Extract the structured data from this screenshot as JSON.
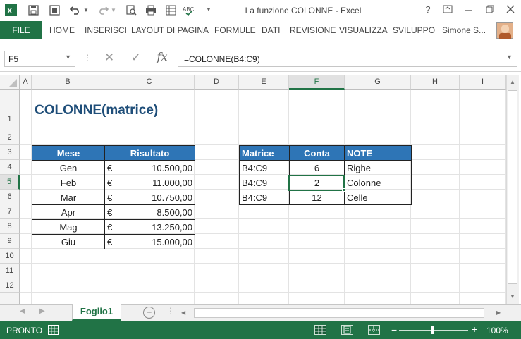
{
  "window": {
    "title": "La funzione COLONNE - Excel",
    "help": "?"
  },
  "ribbon": {
    "file_label": "FILE",
    "tabs": [
      "HOME",
      "INSERISCI",
      "LAYOUT DI PAGINA",
      "FORMULE",
      "DATI",
      "REVISIONE",
      "VISUALIZZA",
      "SVILUPPO"
    ],
    "user_name": "Simone S..."
  },
  "formula_bar": {
    "name_box": "F5",
    "formula": "=COLONNE(B4:C9)",
    "fx_label": "fx"
  },
  "columns": [
    "A",
    "B",
    "C",
    "D",
    "E",
    "F",
    "G",
    "H",
    "I"
  ],
  "rows": [
    "1",
    "2",
    "3",
    "4",
    "5",
    "6",
    "7",
    "8",
    "9",
    "10",
    "11",
    "12"
  ],
  "selected_cell": "F5",
  "sheet": {
    "title": "COLONNE(matrice)",
    "table1": {
      "headers": [
        "Mese",
        "Risultato"
      ],
      "currency": "€",
      "rows": [
        {
          "month": "Gen",
          "amount": "10.500,00"
        },
        {
          "month": "Feb",
          "amount": "11.000,00"
        },
        {
          "month": "Mar",
          "amount": "10.750,00"
        },
        {
          "month": "Apr",
          "amount": "8.500,00"
        },
        {
          "month": "Mag",
          "amount": "13.250,00"
        },
        {
          "month": "Giu",
          "amount": "15.000,00"
        }
      ]
    },
    "table2": {
      "headers": [
        "Matrice",
        "Conta",
        "NOTE"
      ],
      "rows": [
        {
          "matrice": "B4:C9",
          "conta": "6",
          "note": "Righe"
        },
        {
          "matrice": "B4:C9",
          "conta": "2",
          "note": "Colonne"
        },
        {
          "matrice": "B4:C9",
          "conta": "12",
          "note": "Celle"
        }
      ]
    }
  },
  "sheet_tabs": [
    "Foglio1"
  ],
  "status": {
    "ready": "PRONTO",
    "zoom": "100%",
    "zoom_out": "−",
    "zoom_in": "+"
  },
  "colors": {
    "excel_green": "#217346",
    "table_header": "#2e75b6",
    "title_text": "#1f4e79"
  }
}
